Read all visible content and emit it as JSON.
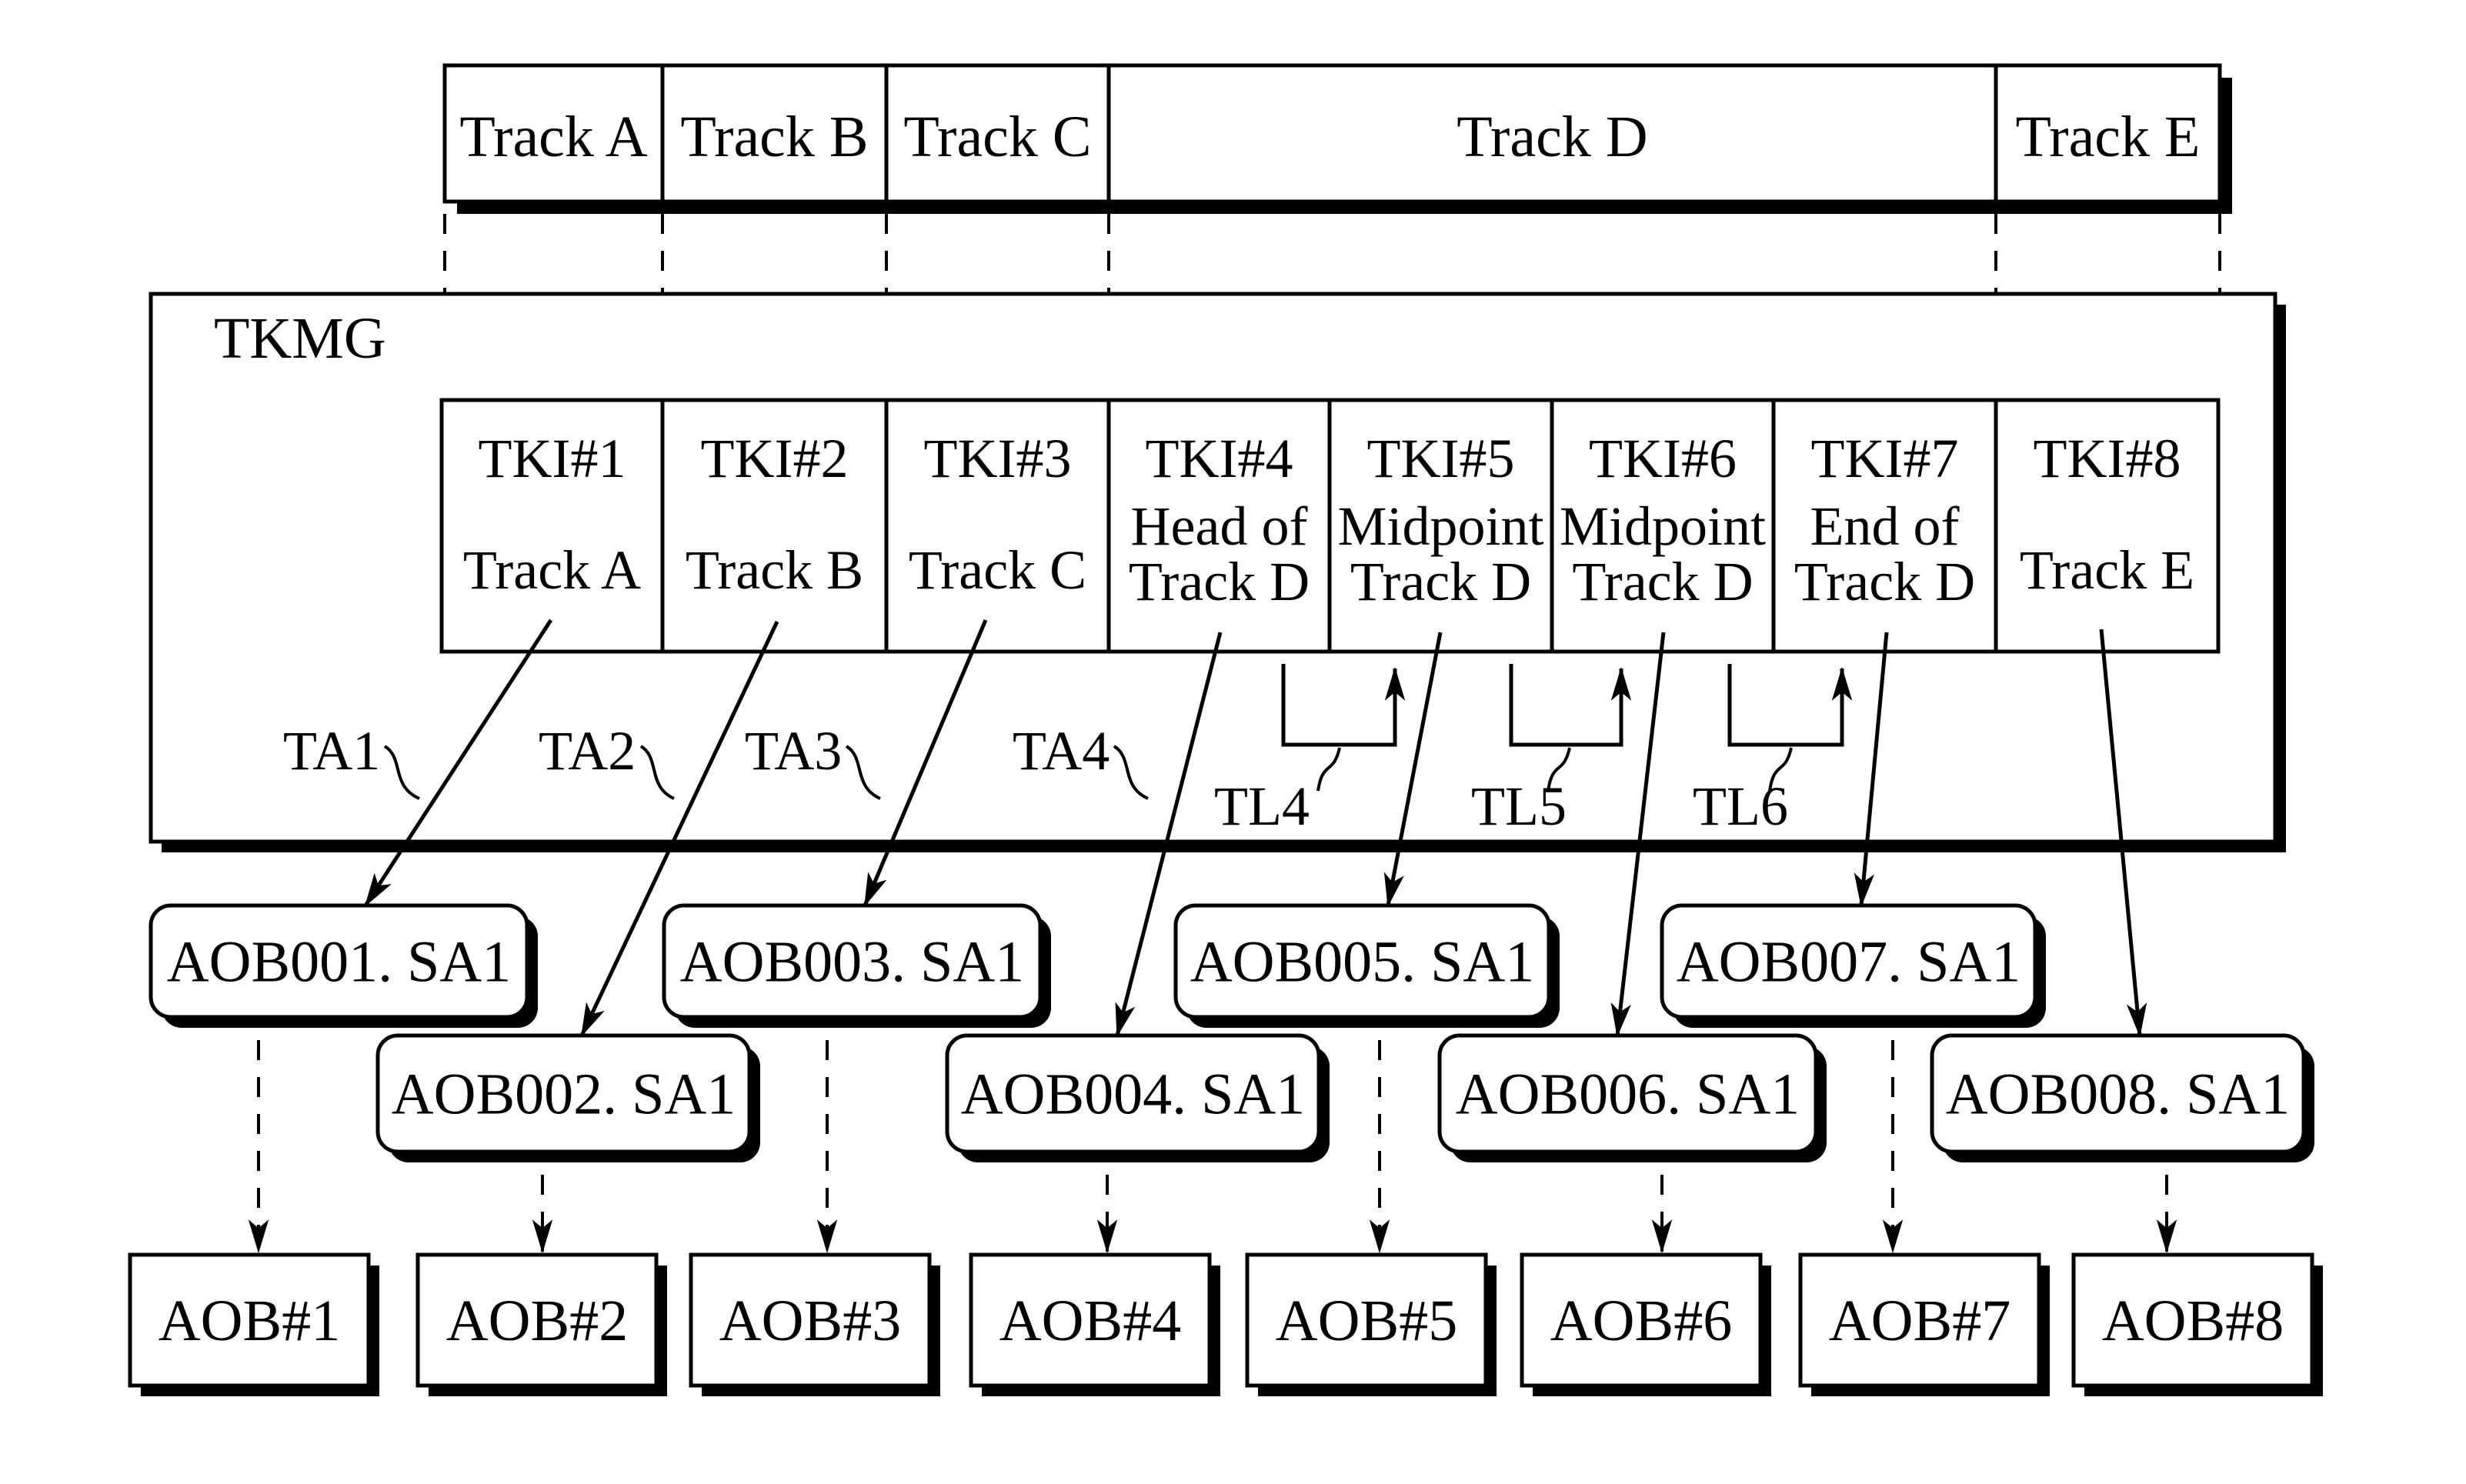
{
  "tracks": [
    "Track A",
    "Track B",
    "Track C",
    "Track D",
    "Track E"
  ],
  "tkmg": {
    "label": "TKMG",
    "tki": [
      {
        "id": "TKI#1",
        "lines": [
          "Track A"
        ]
      },
      {
        "id": "TKI#2",
        "lines": [
          "Track B"
        ]
      },
      {
        "id": "TKI#3",
        "lines": [
          "Track C"
        ]
      },
      {
        "id": "TKI#4",
        "lines": [
          "Head of",
          "Track D"
        ]
      },
      {
        "id": "TKI#5",
        "lines": [
          "Midpoint",
          "Track D"
        ]
      },
      {
        "id": "TKI#6",
        "lines": [
          "Midpoint",
          "Track D"
        ]
      },
      {
        "id": "TKI#7",
        "lines": [
          "End of",
          "Track D"
        ]
      },
      {
        "id": "TKI#8",
        "lines": [
          "Track E"
        ]
      }
    ],
    "ta_labels": [
      "TA1",
      "TA2",
      "TA3",
      "TA4"
    ],
    "tl_labels": [
      "TL4",
      "TL5",
      "TL6"
    ]
  },
  "sa_files": [
    "AOB001. SA1",
    "AOB002. SA1",
    "AOB003. SA1",
    "AOB004. SA1",
    "AOB005. SA1",
    "AOB006. SA1",
    "AOB007. SA1",
    "AOB008. SA1"
  ],
  "aobs": [
    "AOB#1",
    "AOB#2",
    "AOB#3",
    "AOB#4",
    "AOB#5",
    "AOB#6",
    "AOB#7",
    "AOB#8"
  ]
}
